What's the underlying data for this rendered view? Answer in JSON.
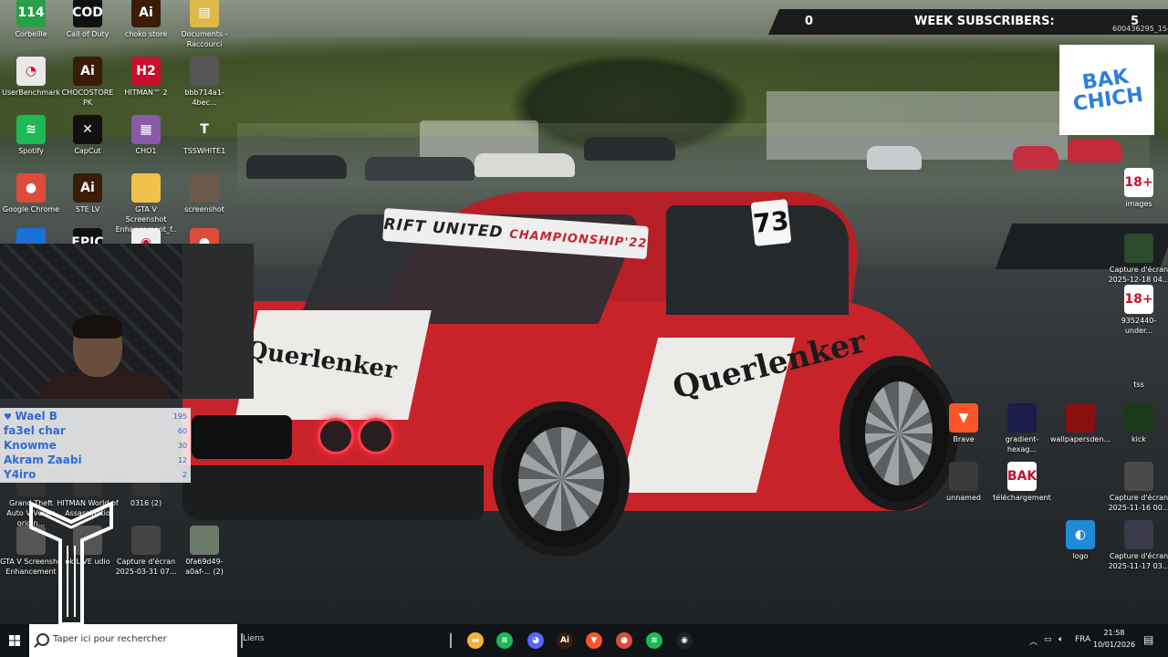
{
  "overlay": {
    "subs_count": "0",
    "week_label": "WEEK SUBSCRIBERS:",
    "week_value": "5",
    "sub_id": "600436295_154...",
    "logo_text": "BAK CHICH"
  },
  "car": {
    "banner_a": "RIFT UNITED",
    "banner_b": "CHAMPIONSHIP'22",
    "number": "73",
    "livery": "Querlenker"
  },
  "desktop_icons": [
    {
      "label": "Corbeille",
      "icon": "k-icon",
      "glyph": "114",
      "color": "#27a048"
    },
    {
      "label": "Call of Duty",
      "icon": "cod-icon",
      "glyph": "COD",
      "color": "#111111"
    },
    {
      "label": "choko store",
      "icon": "ai-icon",
      "glyph": "Ai",
      "color": "#3b1c06"
    },
    {
      "label": "Documents - Raccourci",
      "icon": "document-icon",
      "glyph": "▤",
      "color": "#e0b84a"
    },
    {
      "label": "UserBenchmark",
      "icon": "gauge-icon",
      "glyph": "◔",
      "color": "#e8e8e8"
    },
    {
      "label": "CHOCOSTORE PK",
      "icon": "ai-icon",
      "glyph": "Ai",
      "color": "#3b1c06"
    },
    {
      "label": "HITMAN™ 2",
      "icon": "hitman-icon",
      "glyph": "H2",
      "color": "#c8102e"
    },
    {
      "label": "bbb714a1-4bec...",
      "icon": "image-thumb-icon",
      "glyph": "",
      "color": "#555555"
    },
    {
      "label": "Spotify",
      "icon": "spotify-icon",
      "glyph": "≋",
      "color": "#1db954"
    },
    {
      "label": "CapCut",
      "icon": "capcut-icon",
      "glyph": "✕",
      "color": "#111111"
    },
    {
      "label": "CHO1",
      "icon": "winrar-icon",
      "glyph": "▦",
      "color": "#8a5aa8"
    },
    {
      "label": "TSSWHITE1",
      "icon": "tss-logo-icon",
      "glyph": "T",
      "color": "transparent"
    },
    {
      "label": "Google Chrome",
      "icon": "chrome-icon",
      "glyph": "●",
      "color": "#dd4b39"
    },
    {
      "label": "STE LV",
      "icon": "ai-icon",
      "glyph": "Ai",
      "color": "#3b1c06"
    },
    {
      "label": "GTA V Screenshot Enhancement_f...",
      "icon": "folder-icon",
      "glyph": "",
      "color": "#f0c24a"
    },
    {
      "label": "screenshot",
      "icon": "image-thumb-icon",
      "glyph": "",
      "color": "#6b5a4a"
    },
    {
      "label": "",
      "icon": "app-icon",
      "glyph": "",
      "color": "#1a6fd8"
    },
    {
      "label": "",
      "icon": "epic-icon",
      "glyph": "EPIC",
      "color": "#111111"
    },
    {
      "label": "",
      "icon": "webcam-icon",
      "glyph": "◉",
      "color": "#eeeeee"
    },
    {
      "label": "",
      "icon": "chrome-icon",
      "glyph": "●",
      "color": "#dd4b39"
    },
    {
      "label": "Grand Theft Auto V Versio origin...",
      "icon": "gta-icon",
      "glyph": "",
      "color": "#333333"
    },
    {
      "label": "HITMAN World of Assassinatio",
      "icon": "hitman-icon",
      "glyph": "",
      "color": "#333333"
    },
    {
      "label": "0316 (2)",
      "icon": "image-thumb-icon",
      "glyph": "",
      "color": "#333333"
    },
    {
      "label": "GTA V Screensho Enhancement",
      "icon": "chrome-icon",
      "glyph": "",
      "color": "#555555"
    },
    {
      "label": "ok LIVE udio",
      "icon": "app-icon",
      "glyph": "",
      "color": "#555555"
    },
    {
      "label": "Capture d'écran 2025-03-31 07...",
      "icon": "image-thumb-icon",
      "glyph": "",
      "color": "#444444"
    },
    {
      "label": "0fa69d49-a0af-... (2)",
      "icon": "image-thumb-icon",
      "glyph": "",
      "color": "#6c7a6a"
    },
    {
      "label": "images",
      "icon": "age18-icon",
      "glyph": "18+",
      "color": "#ffffff"
    },
    {
      "label": "Capture d'écran 2025-12-18 04...",
      "icon": "image-thumb-icon",
      "glyph": "",
      "color": "#2d4a2d"
    },
    {
      "label": "9352440-under...",
      "icon": "age18-icon",
      "glyph": "18+",
      "color": "#ffffff"
    },
    {
      "label": "tss",
      "icon": "tss-icon",
      "glyph": "",
      "color": "transparent"
    },
    {
      "label": "Brave",
      "icon": "brave-icon",
      "glyph": "▼",
      "color": "#fb542b"
    },
    {
      "label": "gradient-hexag...",
      "icon": "image-thumb-icon",
      "glyph": "",
      "color": "#1c1c4a"
    },
    {
      "label": "wallpapersden...",
      "icon": "image-thumb-icon",
      "glyph": "",
      "color": "#8a1010"
    },
    {
      "label": "kick",
      "icon": "kick-icon",
      "glyph": "",
      "color": "#1a3a1a"
    },
    {
      "label": "unnamed",
      "icon": "image-thumb-icon",
      "glyph": "",
      "color": "#3a3a3a"
    },
    {
      "label": "téléchargement",
      "icon": "image-thumb-icon",
      "glyph": "BAK",
      "color": "#ffffff"
    },
    {
      "label": "Capture d'écran 2025-11-16 00...",
      "icon": "image-thumb-icon",
      "glyph": "",
      "color": "#4a4a4a"
    },
    {
      "label": "logo",
      "icon": "edge-icon",
      "glyph": "◐",
      "color": "#1f8ad6"
    },
    {
      "label": "Capture d'écran 2025-11-17 03...",
      "icon": "image-thumb-icon",
      "glyph": "",
      "color": "#3a3a4a"
    }
  ],
  "leaderboard": [
    {
      "name": "Wael B",
      "value": "195"
    },
    {
      "name": "fa3el char",
      "value": "60"
    },
    {
      "name": "Knowme",
      "value": "30"
    },
    {
      "name": "Akram Zaabi",
      "value": "12"
    },
    {
      "name": "Y4iro",
      "value": "2"
    }
  ],
  "taskbar": {
    "search_placeholder": "Taper ici pour rechercher",
    "links_label": "Liens",
    "pinned": [
      {
        "icon": "file-explorer-icon",
        "glyph": "▬",
        "color": "#f2b13a"
      },
      {
        "icon": "spotify-icon",
        "glyph": "≋",
        "color": "#1db954"
      },
      {
        "icon": "discord-icon",
        "glyph": "◕",
        "color": "#5865f2"
      },
      {
        "icon": "illustrator-icon",
        "glyph": "Ai",
        "color": "#3b1c06"
      },
      {
        "icon": "brave-icon",
        "glyph": "▼",
        "color": "#fb542b"
      },
      {
        "icon": "chrome-icon",
        "glyph": "●",
        "color": "#dd4b39"
      },
      {
        "icon": "spotify-icon",
        "glyph": "≋",
        "color": "#1db954"
      },
      {
        "icon": "obs-icon",
        "glyph": "◉",
        "color": "#222222"
      }
    ],
    "language": "FRA",
    "time": "21:58",
    "date": "10/01/2026"
  }
}
